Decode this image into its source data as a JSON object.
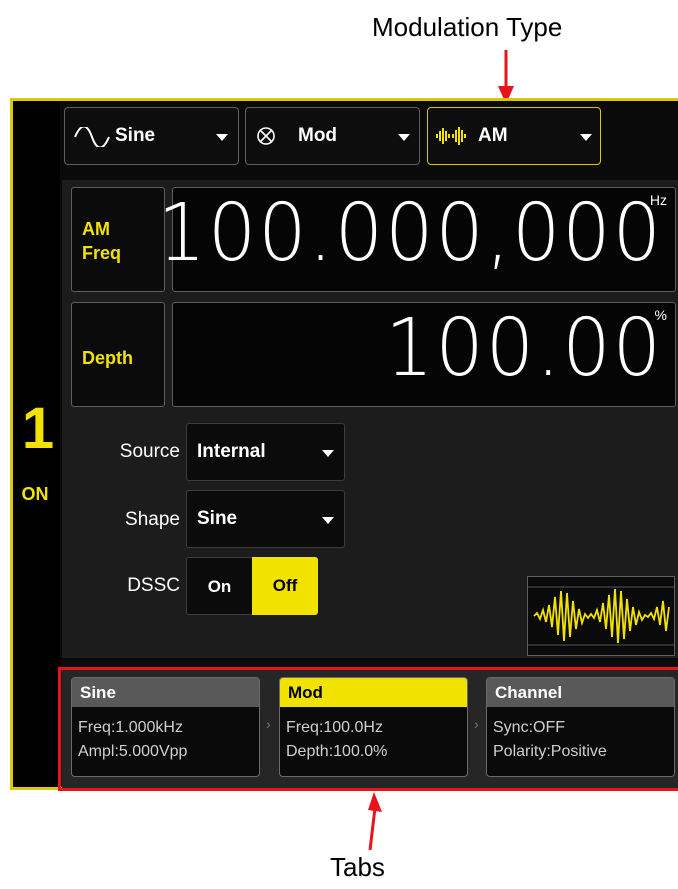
{
  "annotations": {
    "modulation_type": "Modulation Type",
    "tabs": "Tabs"
  },
  "channel": {
    "number": "1",
    "state": "ON"
  },
  "dropdowns": {
    "waveform": "Sine",
    "mode": "Mod",
    "mod_type": "AM"
  },
  "params": {
    "am_freq": {
      "label_line1": "AM",
      "label_line2": "Freq",
      "value": "100.000,000",
      "unit": "Hz"
    },
    "depth": {
      "label": "Depth",
      "value": "100.00",
      "unit": "%"
    }
  },
  "settings": {
    "source": {
      "label": "Source",
      "value": "Internal"
    },
    "shape": {
      "label": "Shape",
      "value": "Sine"
    },
    "dssc": {
      "label": "DSSC",
      "on": "On",
      "off": "Off",
      "selected": "Off"
    }
  },
  "tabs": [
    {
      "title": "Sine",
      "line1": "Freq:1.000kHz",
      "line2": "Ampl:5.000Vpp",
      "active": false
    },
    {
      "title": "Mod",
      "line1": "Freq:100.0Hz",
      "line2": "Depth:100.0%",
      "active": true
    },
    {
      "title": "Channel",
      "line1": "Sync:OFF",
      "line2": "Polarity:Positive",
      "active": false
    }
  ],
  "colors": {
    "accent": "#f2e200",
    "annotation_red": "#e8141a",
    "panel": "#1c1c1c",
    "frame": "#d9c90a"
  },
  "icons": {
    "waveform": "sine-wave-icon",
    "mode": "modulation-circle-icon",
    "mod_type": "am-waveform-icon",
    "preview": "am-preview-icon"
  }
}
